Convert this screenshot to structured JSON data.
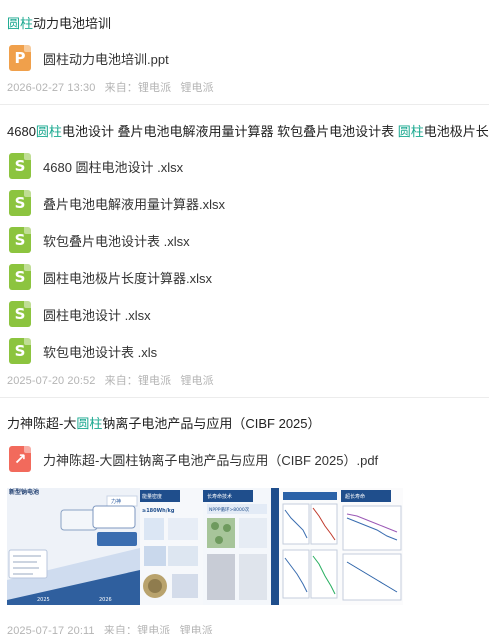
{
  "results": [
    {
      "title_pre": "",
      "title_hl": "圆柱",
      "title_post": "动力电池培训",
      "files": [
        {
          "name": "圆柱动力电池培训.ppt",
          "icon": "ppt-file-icon",
          "letter": "P"
        }
      ],
      "date": "2026-02-27 13:30",
      "from_label": "来自：",
      "source": "锂电派",
      "author": "锂电派"
    },
    {
      "title_pre": "4680",
      "title_hl": "圆柱",
      "title_mid": "电池设计 叠片电池电解液用量计算器 软包叠片电池设计表 ",
      "title_hl2": "圆柱",
      "title_post": "电池极片长度计算器",
      "files": [
        {
          "name": "4680 圆柱电池设计 .xlsx",
          "icon": "xlsx-file-icon",
          "letter": "S"
        },
        {
          "name": "叠片电池电解液用量计算器.xlsx",
          "icon": "xlsx-file-icon",
          "letter": "S"
        },
        {
          "name": "软包叠片电池设计表 .xlsx",
          "icon": "xlsx-file-icon",
          "letter": "S"
        },
        {
          "name": "圆柱电池极片长度计算器.xlsx",
          "icon": "xlsx-file-icon",
          "letter": "S"
        },
        {
          "name": "圆柱电池设计 .xlsx",
          "icon": "xlsx-file-icon",
          "letter": "S"
        },
        {
          "name": "软包电池设计表 .xls",
          "icon": "xls-file-icon",
          "letter": "S"
        }
      ],
      "date": "2025-07-20 20:52",
      "from_label": "来自：",
      "source": "锂电派",
      "author": "锂电派"
    },
    {
      "title_pre": "力神陈超-大",
      "title_hl": "圆柱",
      "title_post": "钠离子电池产品与应用（CIBF 2025）",
      "files": [
        {
          "name": "力神陈超-大圆柱钠离子电池产品与应用（CIBF 2025）.pdf",
          "icon": "pdf-file-icon",
          "letter": "↗"
        }
      ],
      "date": "2025-07-17 20:11",
      "from_label": "来自：",
      "source": "锂电派",
      "author": "锂电派"
    }
  ],
  "thumbnails": {
    "t1_title": "新型钠电池",
    "t1_logo": "力神",
    "t1_year_a": "2025",
    "t1_year_b": "2026",
    "t2_title": "能量密度",
    "t2_value": "≥180Wh/kg",
    "t3_title": "长寿命技术",
    "t3_value": "NPPP循环>8000次",
    "t5_title": "超长寿命"
  },
  "colors": {
    "highlight": "#19a88f",
    "ppt": "#f0a04b",
    "xlsx": "#8cc43f",
    "pdf": "#f26a5c",
    "meta": "#b4b4b4"
  }
}
